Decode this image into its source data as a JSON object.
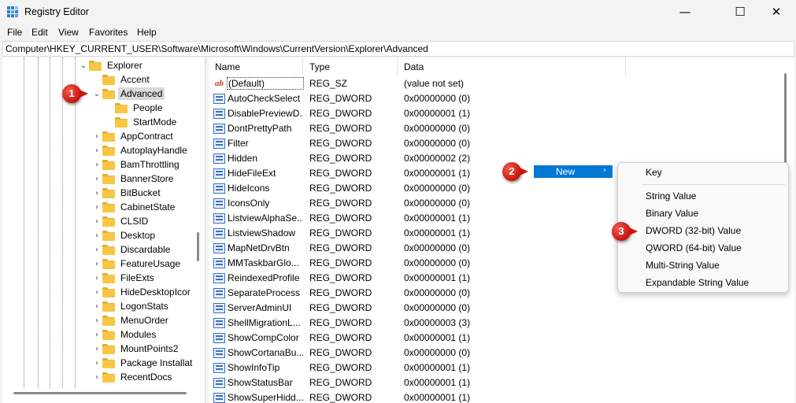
{
  "window": {
    "title": "Registry Editor",
    "minimize_glyph": "—",
    "maximize_glyph": "☐",
    "close_glyph": "✕"
  },
  "menubar": [
    "File",
    "Edit",
    "View",
    "Favorites",
    "Help"
  ],
  "address": "Computer\\HKEY_CURRENT_USER\\Software\\Microsoft\\Windows\\CurrentVersion\\Explorer\\Advanced",
  "tree": [
    {
      "label": "Explorer",
      "expander": "⌄",
      "selected": false
    },
    {
      "label": "Accent",
      "expander": "",
      "selected": false
    },
    {
      "label": "Advanced",
      "expander": "⌄",
      "selected": true
    },
    {
      "label": "People",
      "expander": "",
      "selected": false
    },
    {
      "label": "StartMode",
      "expander": "",
      "selected": false
    },
    {
      "label": "AppContract",
      "expander": "›",
      "selected": false
    },
    {
      "label": "AutoplayHandle",
      "expander": "›",
      "selected": false
    },
    {
      "label": "BamThrottling",
      "expander": "›",
      "selected": false
    },
    {
      "label": "BannerStore",
      "expander": "›",
      "selected": false
    },
    {
      "label": "BitBucket",
      "expander": "›",
      "selected": false
    },
    {
      "label": "CabinetState",
      "expander": "›",
      "selected": false
    },
    {
      "label": "CLSID",
      "expander": "›",
      "selected": false
    },
    {
      "label": "Desktop",
      "expander": "›",
      "selected": false
    },
    {
      "label": "Discardable",
      "expander": "›",
      "selected": false
    },
    {
      "label": "FeatureUsage",
      "expander": "›",
      "selected": false
    },
    {
      "label": "FileExts",
      "expander": "›",
      "selected": false
    },
    {
      "label": "HideDesktopIcor",
      "expander": "›",
      "selected": false
    },
    {
      "label": "LogonStats",
      "expander": "›",
      "selected": false
    },
    {
      "label": "MenuOrder",
      "expander": "›",
      "selected": false
    },
    {
      "label": "Modules",
      "expander": "›",
      "selected": false
    },
    {
      "label": "MountPoints2",
      "expander": "›",
      "selected": false
    },
    {
      "label": "Package Installat",
      "expander": "›",
      "selected": false
    },
    {
      "label": "RecentDocs",
      "expander": "›",
      "selected": false
    }
  ],
  "columns": [
    "Name",
    "Type",
    "Data"
  ],
  "values": [
    {
      "name": "(Default)",
      "type": "REG_SZ",
      "data": "(value not set)",
      "icon": "string-value-icon",
      "icon_text": "ab"
    },
    {
      "name": "AutoCheckSelect",
      "type": "REG_DWORD",
      "data": "0x00000000 (0)",
      "icon": "dword-value-icon",
      "icon_text": ""
    },
    {
      "name": "DisablePreviewD...",
      "type": "REG_DWORD",
      "data": "0x00000001 (1)",
      "icon": "dword-value-icon",
      "icon_text": ""
    },
    {
      "name": "DontPrettyPath",
      "type": "REG_DWORD",
      "data": "0x00000000 (0)",
      "icon": "dword-value-icon",
      "icon_text": ""
    },
    {
      "name": "Filter",
      "type": "REG_DWORD",
      "data": "0x00000000 (0)",
      "icon": "dword-value-icon",
      "icon_text": ""
    },
    {
      "name": "Hidden",
      "type": "REG_DWORD",
      "data": "0x00000002 (2)",
      "icon": "dword-value-icon",
      "icon_text": ""
    },
    {
      "name": "HideFileExt",
      "type": "REG_DWORD",
      "data": "0x00000001 (1)",
      "icon": "dword-value-icon",
      "icon_text": ""
    },
    {
      "name": "HideIcons",
      "type": "REG_DWORD",
      "data": "0x00000000 (0)",
      "icon": "dword-value-icon",
      "icon_text": ""
    },
    {
      "name": "IconsOnly",
      "type": "REG_DWORD",
      "data": "0x00000000 (0)",
      "icon": "dword-value-icon",
      "icon_text": ""
    },
    {
      "name": "ListviewAlphaSe...",
      "type": "REG_DWORD",
      "data": "0x00000001 (1)",
      "icon": "dword-value-icon",
      "icon_text": ""
    },
    {
      "name": "ListviewShadow",
      "type": "REG_DWORD",
      "data": "0x00000001 (1)",
      "icon": "dword-value-icon",
      "icon_text": ""
    },
    {
      "name": "MapNetDrvBtn",
      "type": "REG_DWORD",
      "data": "0x00000000 (0)",
      "icon": "dword-value-icon",
      "icon_text": ""
    },
    {
      "name": "MMTaskbarGlo...",
      "type": "REG_DWORD",
      "data": "0x00000000 (0)",
      "icon": "dword-value-icon",
      "icon_text": ""
    },
    {
      "name": "ReindexedProfile",
      "type": "REG_DWORD",
      "data": "0x00000001 (1)",
      "icon": "dword-value-icon",
      "icon_text": ""
    },
    {
      "name": "SeparateProcess",
      "type": "REG_DWORD",
      "data": "0x00000000 (0)",
      "icon": "dword-value-icon",
      "icon_text": ""
    },
    {
      "name": "ServerAdminUI",
      "type": "REG_DWORD",
      "data": "0x00000000 (0)",
      "icon": "dword-value-icon",
      "icon_text": ""
    },
    {
      "name": "ShellMigrationL...",
      "type": "REG_DWORD",
      "data": "0x00000003 (3)",
      "icon": "dword-value-icon",
      "icon_text": ""
    },
    {
      "name": "ShowCompColor",
      "type": "REG_DWORD",
      "data": "0x00000001 (1)",
      "icon": "dword-value-icon",
      "icon_text": ""
    },
    {
      "name": "ShowCortanaBu...",
      "type": "REG_DWORD",
      "data": "0x00000000 (0)",
      "icon": "dword-value-icon",
      "icon_text": ""
    },
    {
      "name": "ShowInfoTip",
      "type": "REG_DWORD",
      "data": "0x00000001 (1)",
      "icon": "dword-value-icon",
      "icon_text": ""
    },
    {
      "name": "ShowStatusBar",
      "type": "REG_DWORD",
      "data": "0x00000001 (1)",
      "icon": "dword-value-icon",
      "icon_text": ""
    },
    {
      "name": "ShowSuperHidd...",
      "type": "REG_DWORD",
      "data": "0x00000001 (1)",
      "icon": "dword-value-icon",
      "icon_text": ""
    }
  ],
  "context_menu": {
    "parent_item": "New",
    "parent_arrow": "›",
    "items": [
      "Key",
      "String Value",
      "Binary Value",
      "DWORD (32-bit) Value",
      "QWORD (64-bit) Value",
      "Multi-String Value",
      "Expandable String Value"
    ]
  },
  "annotations": [
    "1",
    "2",
    "3"
  ],
  "colors": {
    "highlight": "#0078d4",
    "badge": "#d9261c",
    "folder": "#f7c744",
    "selection": "#dadada"
  }
}
